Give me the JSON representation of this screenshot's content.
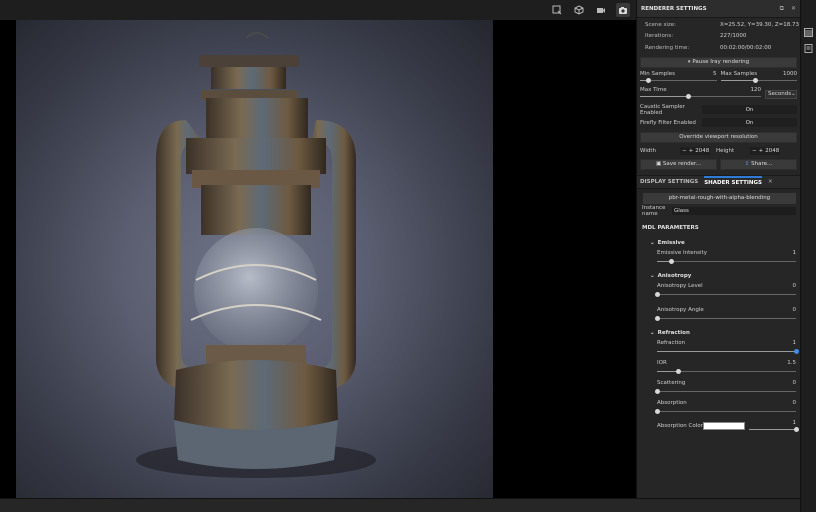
{
  "viewport": {
    "tools": [
      "select-tool-icon",
      "cube-icon",
      "camera-icon",
      "screenshot-icon"
    ]
  },
  "renderer": {
    "title": "RENDERER SETTINGS",
    "stats": [
      {
        "key": "Scene size:",
        "value": "X=25.52, Y=39.30, Z=18.73"
      },
      {
        "key": "Iterations:",
        "value": "227/1000"
      },
      {
        "key": "Rendering time:",
        "value": "00:02:00/00:02:00"
      }
    ],
    "pause_label": "Pause Iray rendering",
    "min_samples": {
      "label": "Min Samples",
      "value": "5",
      "fraction": 0.1
    },
    "max_samples": {
      "label": "Max Samples",
      "value": "1000",
      "fraction": 0.45
    },
    "max_time": {
      "label": "Max Time",
      "value": "120",
      "fraction": 0.4,
      "unit": "Seconds"
    },
    "caustic": {
      "label": "Caustic Sampler Enabled",
      "value": "On"
    },
    "firefly": {
      "label": "Firefly Filter Enabled",
      "value": "On"
    },
    "override_label": "Override viewport resolution",
    "width": {
      "label": "Width",
      "value": "2048"
    },
    "height": {
      "label": "Height",
      "value": "2048"
    },
    "save_label": "Save render...",
    "share_label": "Share..."
  },
  "tabs": {
    "display": "DISPLAY SETTINGS",
    "shader": "SHADER SETTINGS"
  },
  "shader": {
    "material": "pbr-metal-rough-with-alpha-blending",
    "instance_label": "Instance name",
    "instance_value": "Glass",
    "mdl_title": "MDL PARAMETERS",
    "sections": {
      "emissive": "Emissive",
      "anisotropy": "Anisotropy",
      "refraction": "Refraction"
    },
    "params": {
      "emissive_intensity": {
        "label": "Emissive Intensity",
        "value": "1",
        "fraction": 0.1
      },
      "anisotropy_level": {
        "label": "Anisotropy Level",
        "value": "0",
        "fraction": 0.0
      },
      "anisotropy_angle": {
        "label": "Anisotropy Angle",
        "value": "0",
        "fraction": 0.0
      },
      "refraction": {
        "label": "Refraction",
        "value": "1",
        "fraction": 1.0
      },
      "ior": {
        "label": "IOR",
        "value": "1.5",
        "fraction": 0.15
      },
      "scattering": {
        "label": "Scattering",
        "value": "0",
        "fraction": 0.0
      },
      "absorption": {
        "label": "Absorption",
        "value": "0",
        "fraction": 0.0
      },
      "absorption_color": {
        "label": "Absorption Color",
        "value": "1",
        "fraction": 1.0,
        "color": "#ffffff"
      }
    }
  },
  "colors": {
    "accent": "#2e7bd6",
    "panel": "#262626"
  }
}
